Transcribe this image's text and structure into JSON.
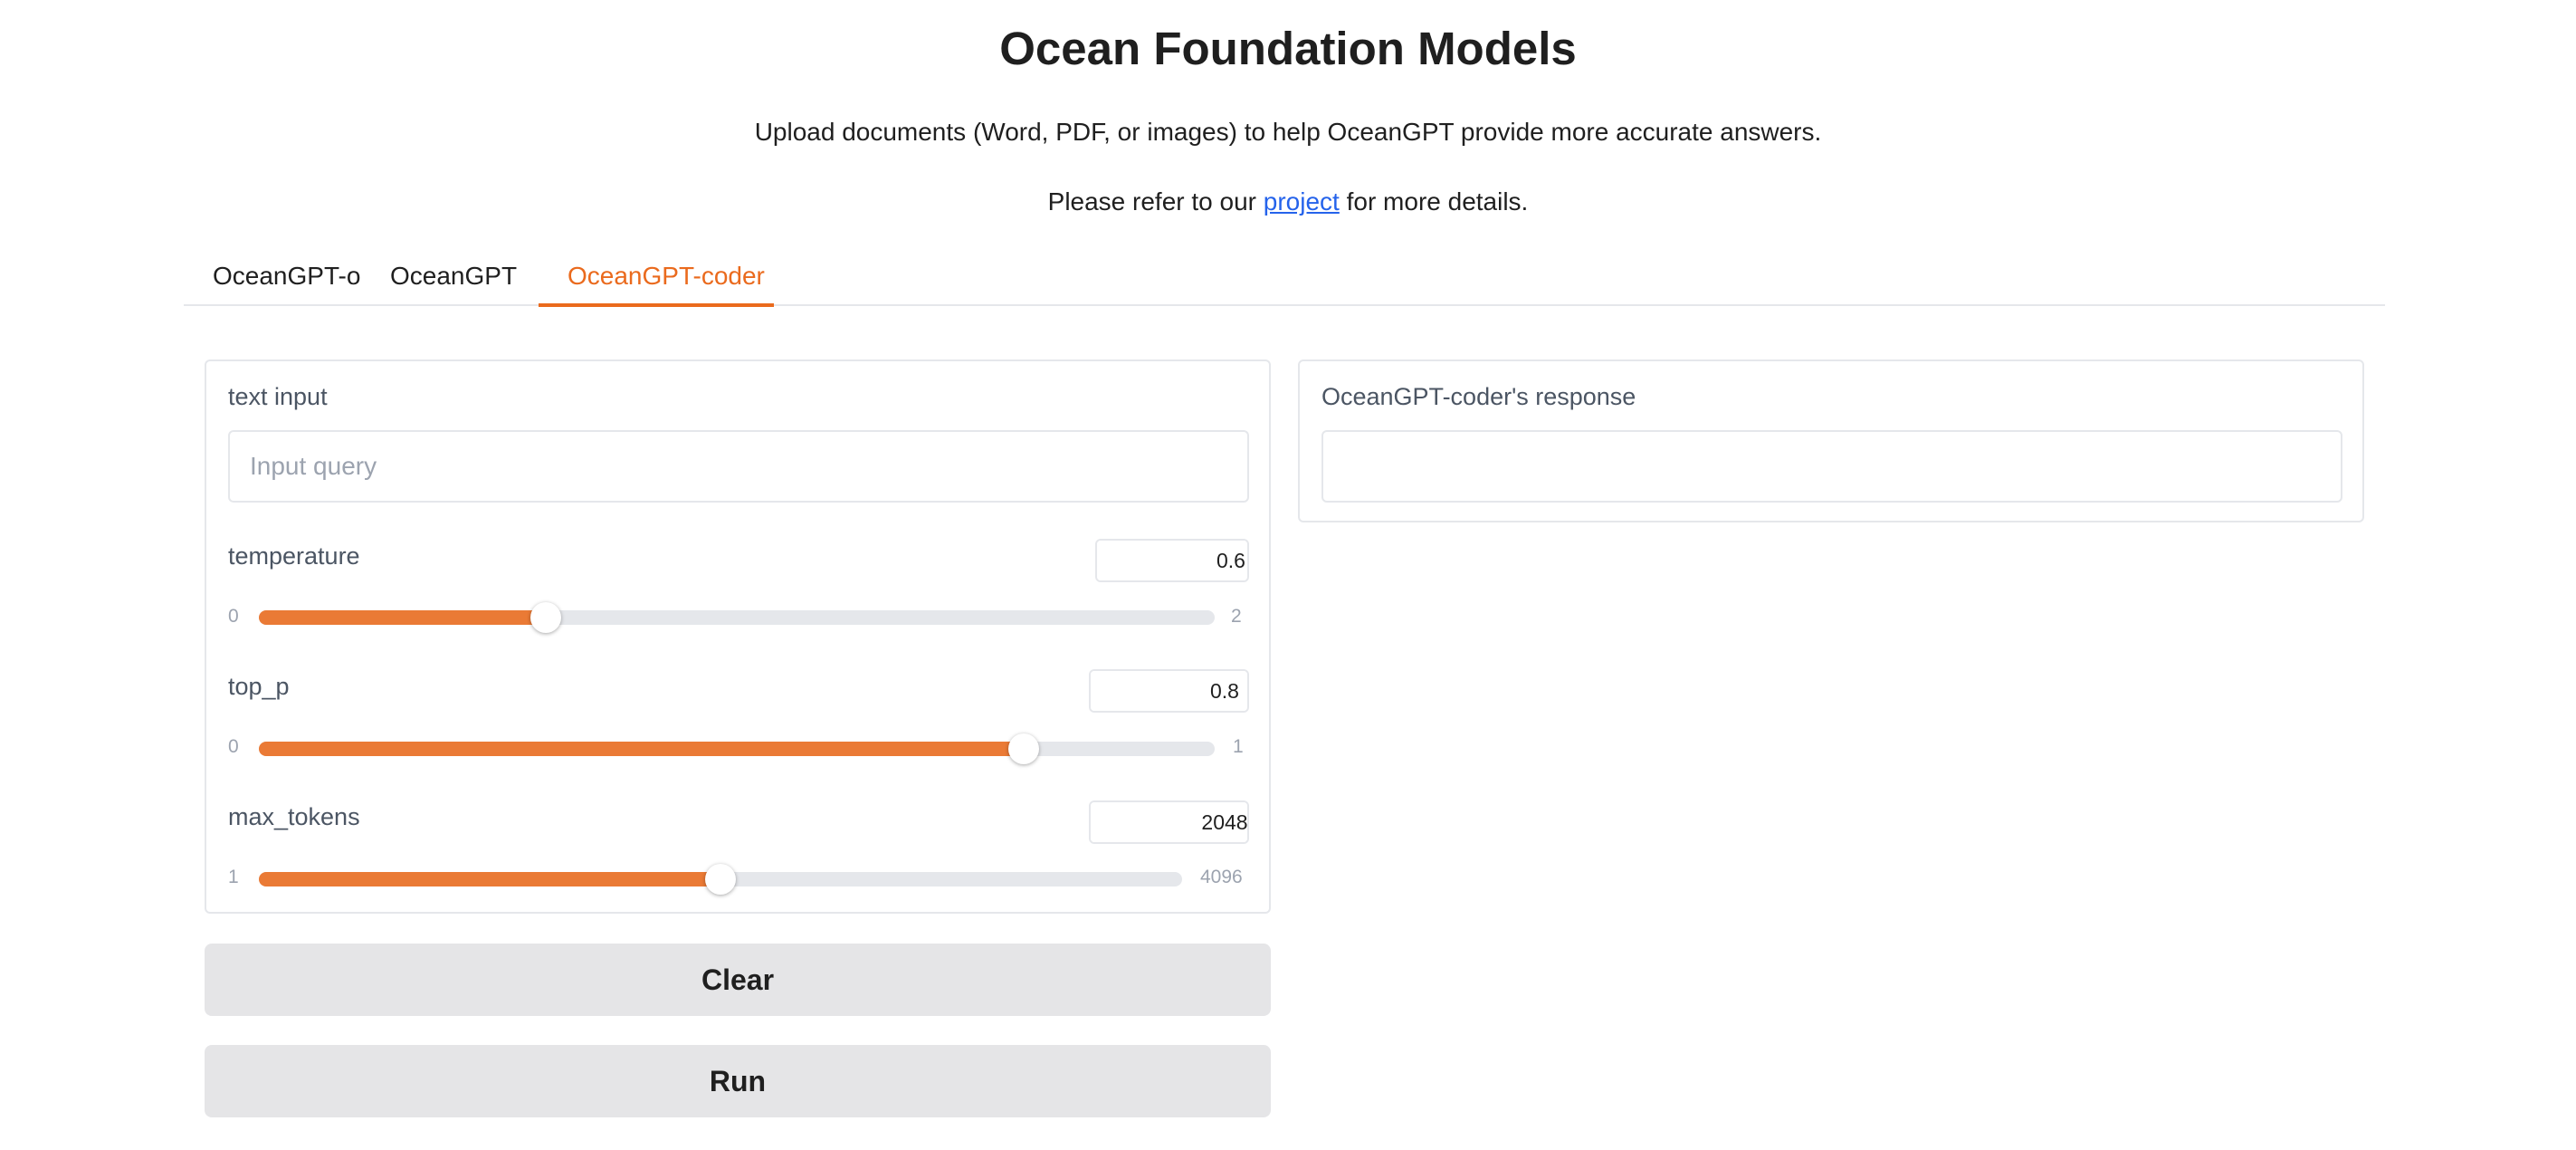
{
  "header": {
    "title": "Ocean Foundation Models",
    "subtitle": "Upload documents (Word, PDF, or images) to help OceanGPT provide more accurate answers.",
    "refer_prefix": "Please refer to our ",
    "refer_link": "project",
    "refer_suffix": " for more details."
  },
  "tabs": [
    {
      "label": "OceanGPT-o"
    },
    {
      "label": "OceanGPT"
    },
    {
      "label": "OceanGPT-coder",
      "active": true
    }
  ],
  "input_panel": {
    "text_label": "text input",
    "text_value": "",
    "text_placeholder": "Input query",
    "sliders": [
      {
        "label": "temperature",
        "value": "0.6",
        "min": "0",
        "max": "2",
        "fraction": 0.3
      },
      {
        "label": "top_p",
        "value": "0.8",
        "min": "0",
        "max": "1",
        "fraction": 0.8
      },
      {
        "label": "max_tokens",
        "value": "2048",
        "min": "1",
        "max": "4096",
        "fraction": 0.5
      }
    ]
  },
  "output_panel": {
    "label": "OceanGPT-coder's response",
    "value": ""
  },
  "buttons": {
    "clear": "Clear",
    "run": "Run"
  },
  "colors": {
    "accent": "#ea6a1d",
    "slider_fill": "#ea7a35",
    "link": "#2563eb",
    "button_bg": "#e5e5e7"
  }
}
